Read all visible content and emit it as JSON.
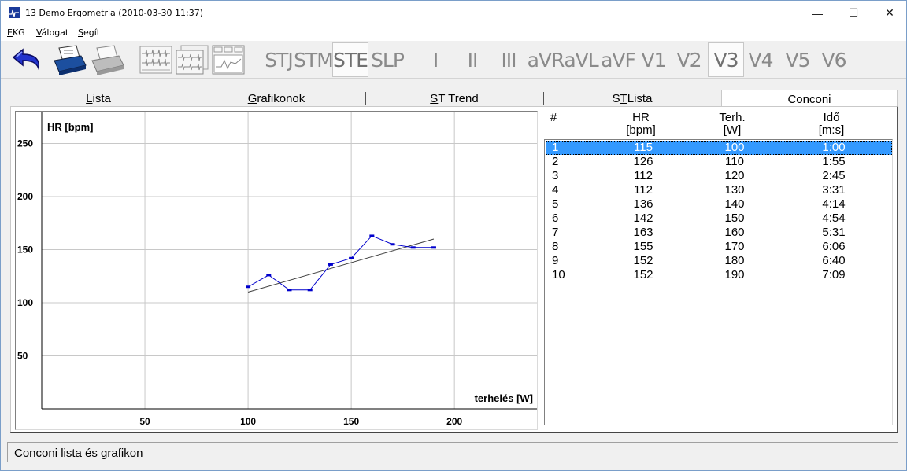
{
  "window": {
    "title": "13 Demo Ergometria (2010-03-30 11:37)",
    "controls": {
      "minimize": "—",
      "maximize": "☐",
      "close": "✕"
    }
  },
  "menu": [
    {
      "label": "EKG",
      "accel": "E",
      "rest": "KG"
    },
    {
      "label": "Válogat",
      "accel": "V",
      "rest": "álogat"
    },
    {
      "label": "Segít",
      "accel": "S",
      "rest": "egít"
    }
  ],
  "toolbar": {
    "icons": [
      "back-arrow-icon",
      "print-icon",
      "print-gray-icon",
      "ecg-strip-icon",
      "ecg-multi-icon",
      "ecg-report-icon"
    ],
    "leads": [
      {
        "label": "STJ",
        "pressed": false
      },
      {
        "label": "STM",
        "pressed": false
      },
      {
        "label": "STE",
        "pressed": true
      },
      {
        "label": "SLP",
        "pressed": false
      },
      {
        "label": "I",
        "pressed": false
      },
      {
        "label": "II",
        "pressed": false
      },
      {
        "label": "III",
        "pressed": false
      },
      {
        "label": "aVR",
        "pressed": false
      },
      {
        "label": "aVL",
        "pressed": false
      },
      {
        "label": "aVF",
        "pressed": false
      },
      {
        "label": "V1",
        "pressed": false
      },
      {
        "label": "V2",
        "pressed": false
      },
      {
        "label": "V3",
        "pressed": true
      },
      {
        "label": "V4",
        "pressed": false
      },
      {
        "label": "V5",
        "pressed": false
      },
      {
        "label": "V6",
        "pressed": false
      }
    ]
  },
  "tabs": [
    {
      "label": "Lista",
      "accel": "L",
      "rest": "ista",
      "active": false
    },
    {
      "label": "Grafikonok",
      "accel": "G",
      "rest": "rafikonok",
      "active": false
    },
    {
      "label": "ST Trend",
      "accel": "S",
      "rest": "T Trend",
      "active": false
    },
    {
      "label": "ST Lista",
      "pre": "S",
      "accel": "T",
      "rest": " Lista",
      "active": false
    },
    {
      "label": "Conconi",
      "active": true
    }
  ],
  "list": {
    "headers": {
      "index": "#",
      "hr": "HR",
      "hr_unit": "[bpm]",
      "load": "Terh.",
      "load_unit": "[W]",
      "time": "Idő",
      "time_unit": "[m:s]"
    },
    "selected_row": 0,
    "rows": [
      {
        "n": "1",
        "hr": "115",
        "load": "100",
        "time": "1:00"
      },
      {
        "n": "2",
        "hr": "126",
        "load": "110",
        "time": "1:55"
      },
      {
        "n": "3",
        "hr": "112",
        "load": "120",
        "time": "2:45"
      },
      {
        "n": "4",
        "hr": "112",
        "load": "130",
        "time": "3:31"
      },
      {
        "n": "5",
        "hr": "136",
        "load": "140",
        "time": "4:14"
      },
      {
        "n": "6",
        "hr": "142",
        "load": "150",
        "time": "4:54"
      },
      {
        "n": "7",
        "hr": "163",
        "load": "160",
        "time": "5:31"
      },
      {
        "n": "8",
        "hr": "155",
        "load": "170",
        "time": "6:06"
      },
      {
        "n": "9",
        "hr": "152",
        "load": "180",
        "time": "6:40"
      },
      {
        "n": "10",
        "hr": "152",
        "load": "190",
        "time": "7:09"
      }
    ]
  },
  "chart_data": {
    "type": "line",
    "ylabel": "HR [bpm]",
    "xlabel": "terhelés [W]",
    "xlim": [
      0,
      240
    ],
    "ylim": [
      0,
      280
    ],
    "xticks": [
      50,
      100,
      150,
      200
    ],
    "yticks": [
      50,
      100,
      150,
      200,
      250
    ],
    "grid": true,
    "series": [
      {
        "x": [
          100,
          110,
          120,
          130,
          140,
          150,
          160,
          170,
          180,
          190
        ],
        "y": [
          115,
          126,
          112,
          112,
          136,
          142,
          163,
          155,
          152,
          152
        ],
        "color": "#0000cc"
      }
    ],
    "trendline": {
      "x": [
        100,
        190
      ],
      "y": [
        110,
        160
      ],
      "color": "#404040"
    }
  },
  "status": {
    "text": "Conconi lista és grafikon"
  }
}
